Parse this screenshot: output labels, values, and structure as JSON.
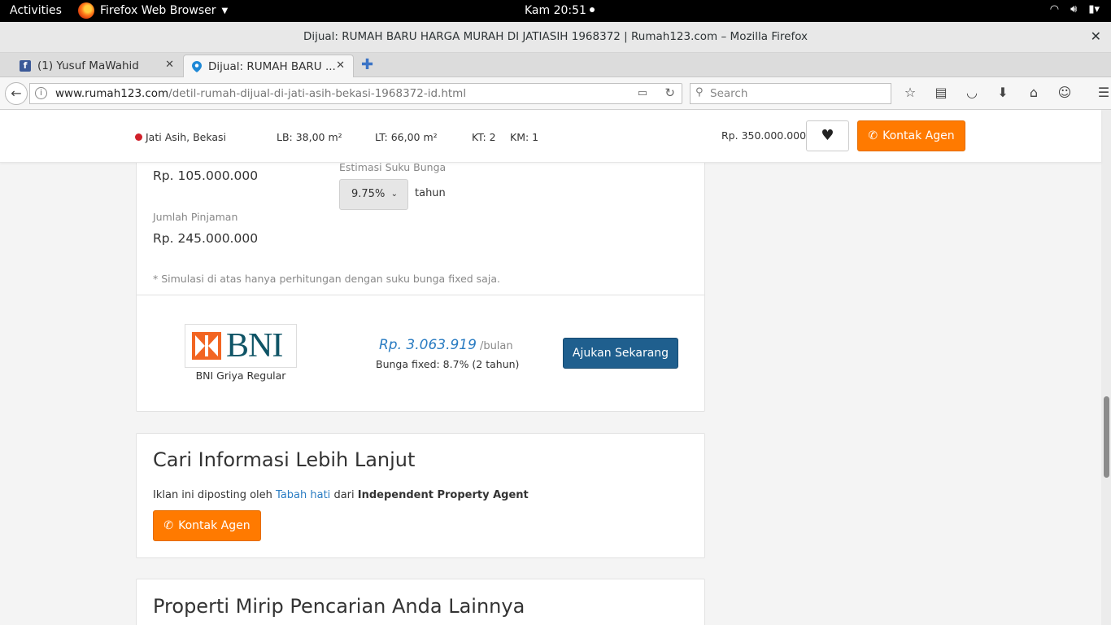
{
  "system_bar": {
    "activities": "Activities",
    "app_name": "Firefox Web Browser",
    "clock": "Kam 20:51"
  },
  "window": {
    "title": "Dijual: RUMAH BARU HARGA MURAH DI JATIASIH 1968372 | Rumah123.com – Mozilla Firefox"
  },
  "tabs": [
    {
      "label": "(1) Yusuf MaWahid"
    },
    {
      "label": "Dijual: RUMAH BARU ..."
    }
  ],
  "navbar": {
    "url_domain": "www.rumah123.com",
    "url_path": "/detil-rumah-dijual-di-jati-asih-bekasi-1968372-id.html",
    "search_placeholder": "Search"
  },
  "listing_bar": {
    "location": "Jati Asih, Bekasi",
    "lb": "LB: 38,00 m²",
    "lt": "LT: 66,00 m²",
    "kt": "KT: 2",
    "km": "KM: 1",
    "price": "Rp. 350.000.000",
    "contact_label": "Kontak Agen"
  },
  "mortgage": {
    "dp_value": "Rp. 105.000.000",
    "rate_label": "Estimasi Suku Bunga",
    "rate_value": "9.75%",
    "tenor_unit": "tahun",
    "loan_label": "Jumlah Pinjaman",
    "loan_value": "Rp. 245.000.000",
    "note": "* Simulasi di atas hanya perhitungan dengan suku bunga fixed saja.",
    "bank_logo_text": "BNI",
    "bank_product": "BNI Griya Regular",
    "installment": "Rp. 3.063.919",
    "installment_unit": "/bulan",
    "rate_info": "Bunga fixed: 8.7% (2 tahun)",
    "apply_label": "Ajukan Sekarang"
  },
  "info_section": {
    "title": "Cari Informasi Lebih Lanjut",
    "posted_prefix": "Iklan ini diposting oleh",
    "agent_name": "Tabah hati",
    "posted_middle": "dari",
    "agency": "Independent Property Agent",
    "contact_label": "Kontak Agen"
  },
  "similar_section": {
    "title": "Properti Mirip Pencarian Anda Lainnya"
  },
  "colors": {
    "accent_orange": "#ff7a00",
    "button_blue": "#1f5f8e",
    "link_blue": "#2a7cc2",
    "bni_teal": "#0f5466",
    "bni_orange": "#f26522"
  }
}
